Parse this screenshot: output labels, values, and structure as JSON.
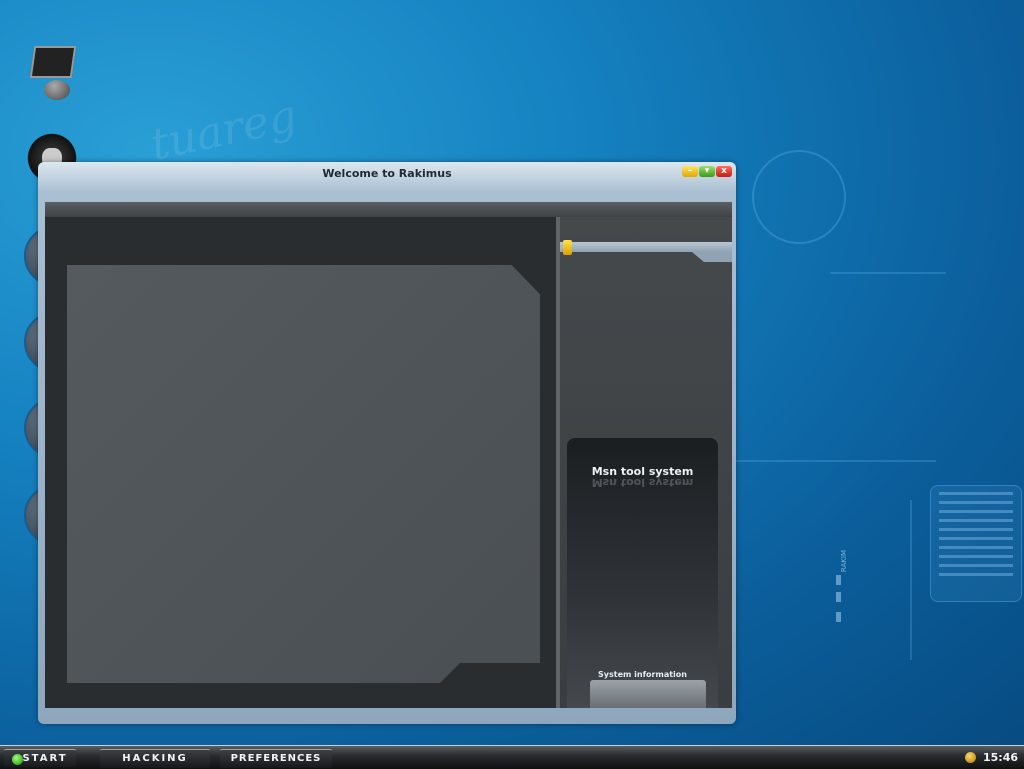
{
  "window": {
    "title": "Welcome to Rakimus",
    "controls": {
      "minimize": "–",
      "maximize": "▾",
      "close": "x"
    }
  },
  "right_panel": {
    "msn_title": "Msn tool system",
    "system_info_label": "System information"
  },
  "taskbar": {
    "start_label": "START",
    "hacking_label": "HACKING",
    "preferences_label": "PREFERENCES",
    "clock": "15:46"
  },
  "wallpaper": {
    "vertical_label": "RAKIM"
  },
  "desktop_icons": [
    "monitor-icon",
    "flame-skull-icon",
    "round-app-icon-1",
    "round-app-icon-2",
    "round-app-icon-3",
    "round-app-icon-4"
  ],
  "colors": {
    "desktop": "#1581c0",
    "accent_yellow": "#e0a800",
    "close_red": "#c41e10"
  }
}
